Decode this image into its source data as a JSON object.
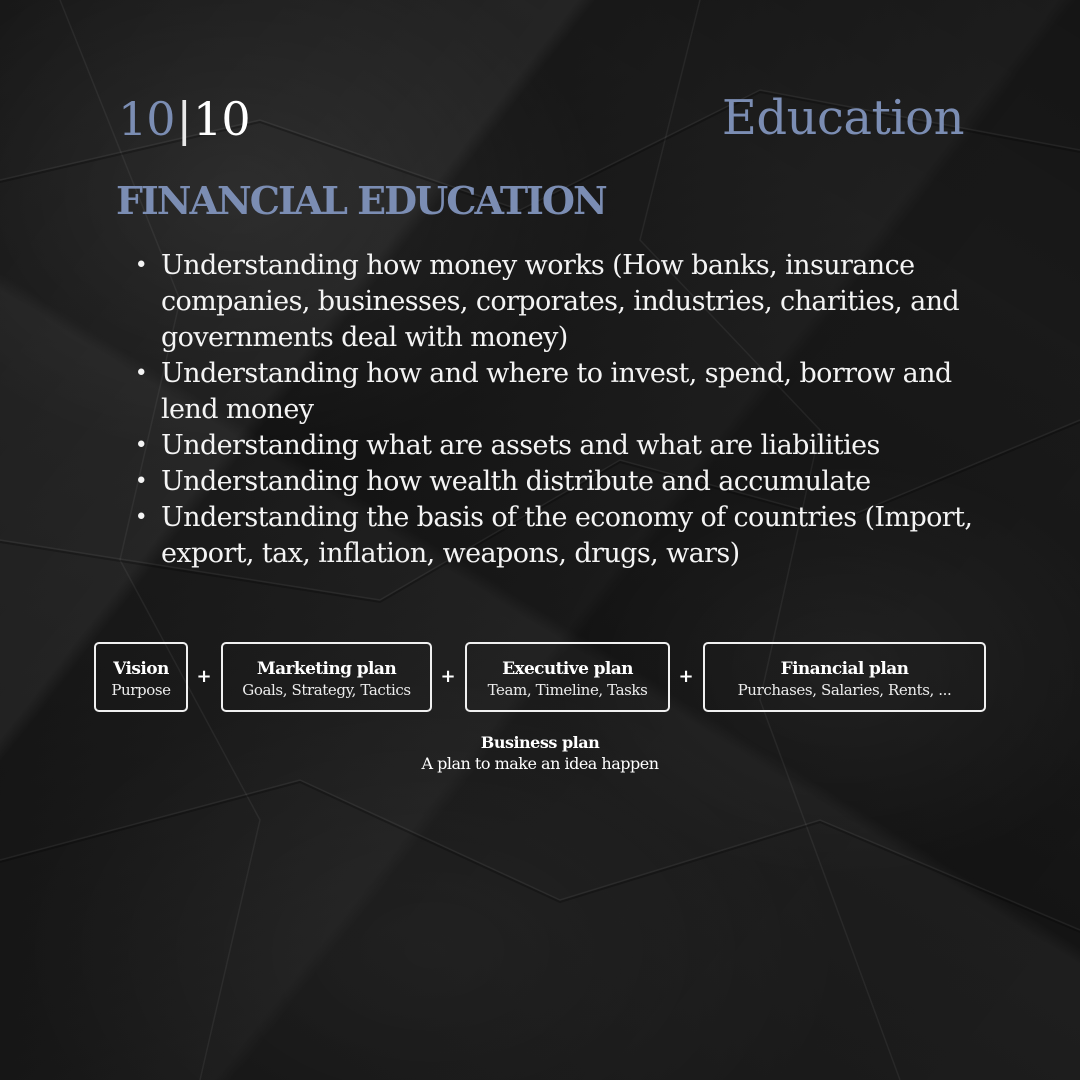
{
  "header": {
    "page_current": "10",
    "page_separator": "|",
    "page_total": "10",
    "topic": "Education"
  },
  "section": {
    "title": "FINANCIAL EDUCATION",
    "bullet_glyph": "•",
    "bullets": [
      "Understanding how money works (How banks, insurance companies, businesses, corporates, industries, charities, and governments deal with money)",
      "Understanding how and where to invest, spend, borrow and lend money",
      "Understanding what are assets and what are liabilities",
      "Understanding how wealth distribute and accumulate",
      "Understanding the basis of the economy of countries (Import, export, tax, inflation, weapons, drugs, wars)"
    ]
  },
  "diagram": {
    "plus": "+",
    "boxes": [
      {
        "title": "Vision",
        "subtitle": "Purpose"
      },
      {
        "title": "Marketing plan",
        "subtitle": "Goals, Strategy, Tactics"
      },
      {
        "title": "Executive plan",
        "subtitle": "Team, Timeline, Tasks"
      },
      {
        "title": "Financial plan",
        "subtitle": "Purchases, Salaries, Rents, ..."
      }
    ],
    "result": {
      "title": "Business plan",
      "subtitle": "A plan to make an idea happen"
    }
  },
  "colors": {
    "accent": "#7b8db3",
    "text": "#ffffff",
    "background": "#171717"
  }
}
